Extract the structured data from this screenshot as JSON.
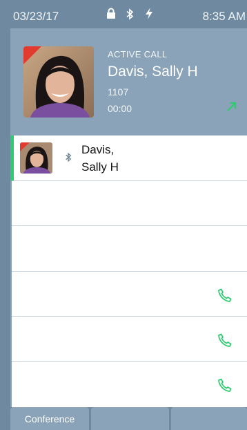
{
  "status_bar": {
    "date": "03/23/17",
    "time": "8:35 AM",
    "icons": [
      "lock-icon",
      "bluetooth-icon",
      "power-icon"
    ]
  },
  "active_call": {
    "label": "ACTIVE CALL",
    "name": "Davis, Sally H",
    "extension": "1107",
    "duration": "00:00",
    "direction_icon": "outgoing-arrow-icon"
  },
  "call_list": [
    {
      "name_line1": "Davis,",
      "name_line2": "Sally H",
      "icon": "bluetooth-icon",
      "active": true
    }
  ],
  "softkeys": [
    "Conference",
    "",
    ""
  ],
  "colors": {
    "accent_green": "#2ecc71",
    "header_bg": "#8aa3b8",
    "status_bg": "#6f8aa0",
    "badge_red": "#e23a2e"
  }
}
